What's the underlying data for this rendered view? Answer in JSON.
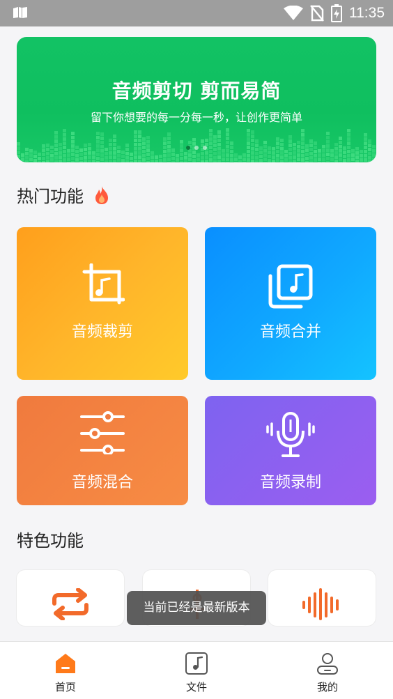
{
  "status_bar": {
    "time": "11:35"
  },
  "banner": {
    "title": "音频剪切 剪而易简",
    "subtitle": "留下你想要的每一分每一秒，让创作更简单",
    "page_count": 3,
    "active_index": 0
  },
  "hot_section": {
    "title": "热门功能"
  },
  "features": [
    {
      "label": "音频裁剪",
      "icon": "crop-music-icon"
    },
    {
      "label": "音频合并",
      "icon": "merge-music-icon"
    },
    {
      "label": "音频混合",
      "icon": "mixer-sliders-icon"
    },
    {
      "label": "音频录制",
      "icon": "microphone-icon"
    }
  ],
  "special_section": {
    "title": "特色功能"
  },
  "special_items": [
    {
      "icon": "repeat-icon"
    },
    {
      "icon": "pitch-icon"
    },
    {
      "icon": "waveform-icon"
    }
  ],
  "toast": {
    "text": "当前已经是最新版本"
  },
  "bottom_nav": [
    {
      "label": "首页",
      "icon": "home-icon",
      "active": true
    },
    {
      "label": "文件",
      "icon": "music-file-icon",
      "active": false
    },
    {
      "label": "我的",
      "icon": "profile-icon",
      "active": false
    }
  ],
  "colors": {
    "banner_green": "#12c264",
    "accent_orange": "#ff9f1c",
    "accent_blue": "#0a8fff",
    "mix_orange": "#f07a3e",
    "record_purple": "#8a60f0"
  }
}
